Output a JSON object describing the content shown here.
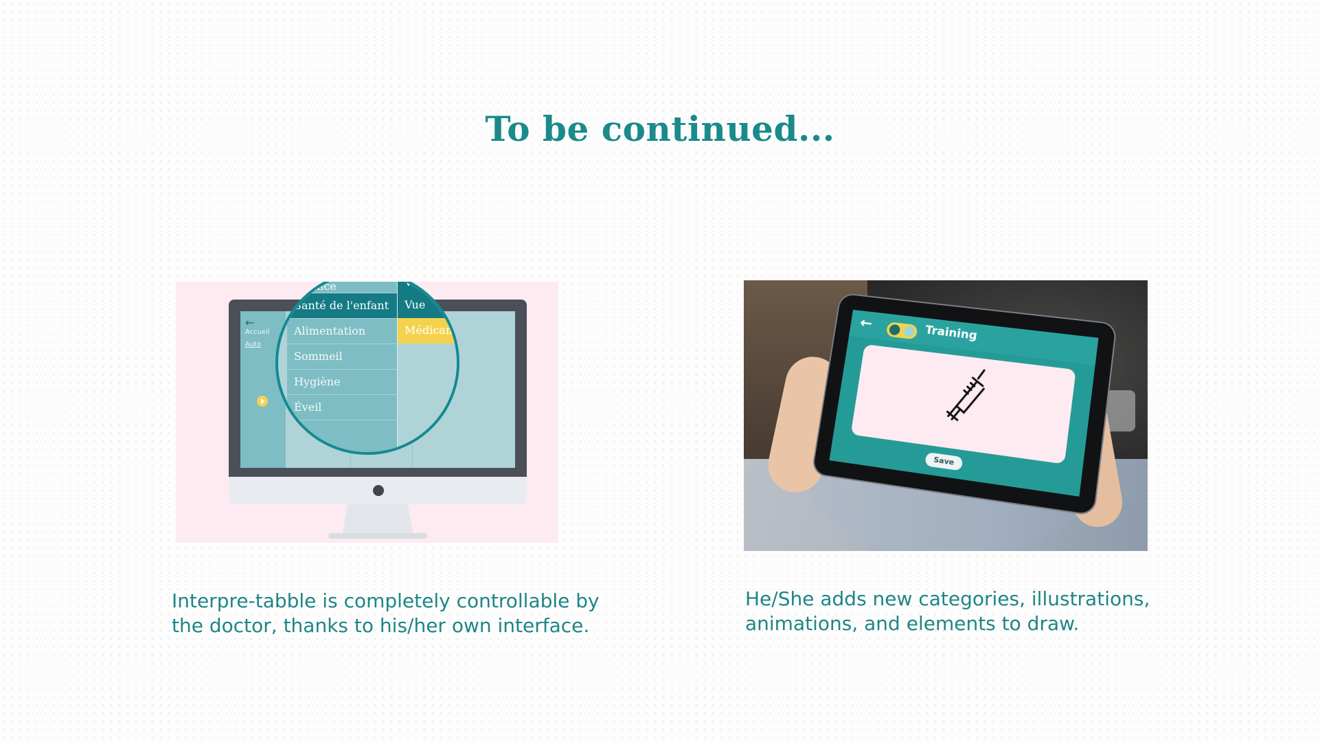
{
  "title": "To be continued...",
  "left": {
    "caption_line1": "Interpre-tabble is completely controllable by",
    "caption_line2": "the doctor, thanks to his/her own interface.",
    "illustration": {
      "back_arrow": "←",
      "sidebar_label1": "Accueil",
      "sidebar_label2": "Auto",
      "menu_items": [
        "...sance",
        "Santé de l'enfant",
        "Alimentation",
        "Sommeil",
        "Hygiène",
        "Éveil"
      ],
      "menu_items_col2": [
        "Vu...",
        "Vue",
        "Médicam..."
      ]
    }
  },
  "right": {
    "caption_line1": "He/She adds new categories, illustrations,",
    "caption_line2": "animations, and elements to draw.",
    "tablet": {
      "back_arrow": "←",
      "title": "Training",
      "save_label": "Save"
    }
  },
  "colors": {
    "teal": "#1a8a8a",
    "pink": "#fdebf1",
    "yellow": "#f3d34d"
  }
}
